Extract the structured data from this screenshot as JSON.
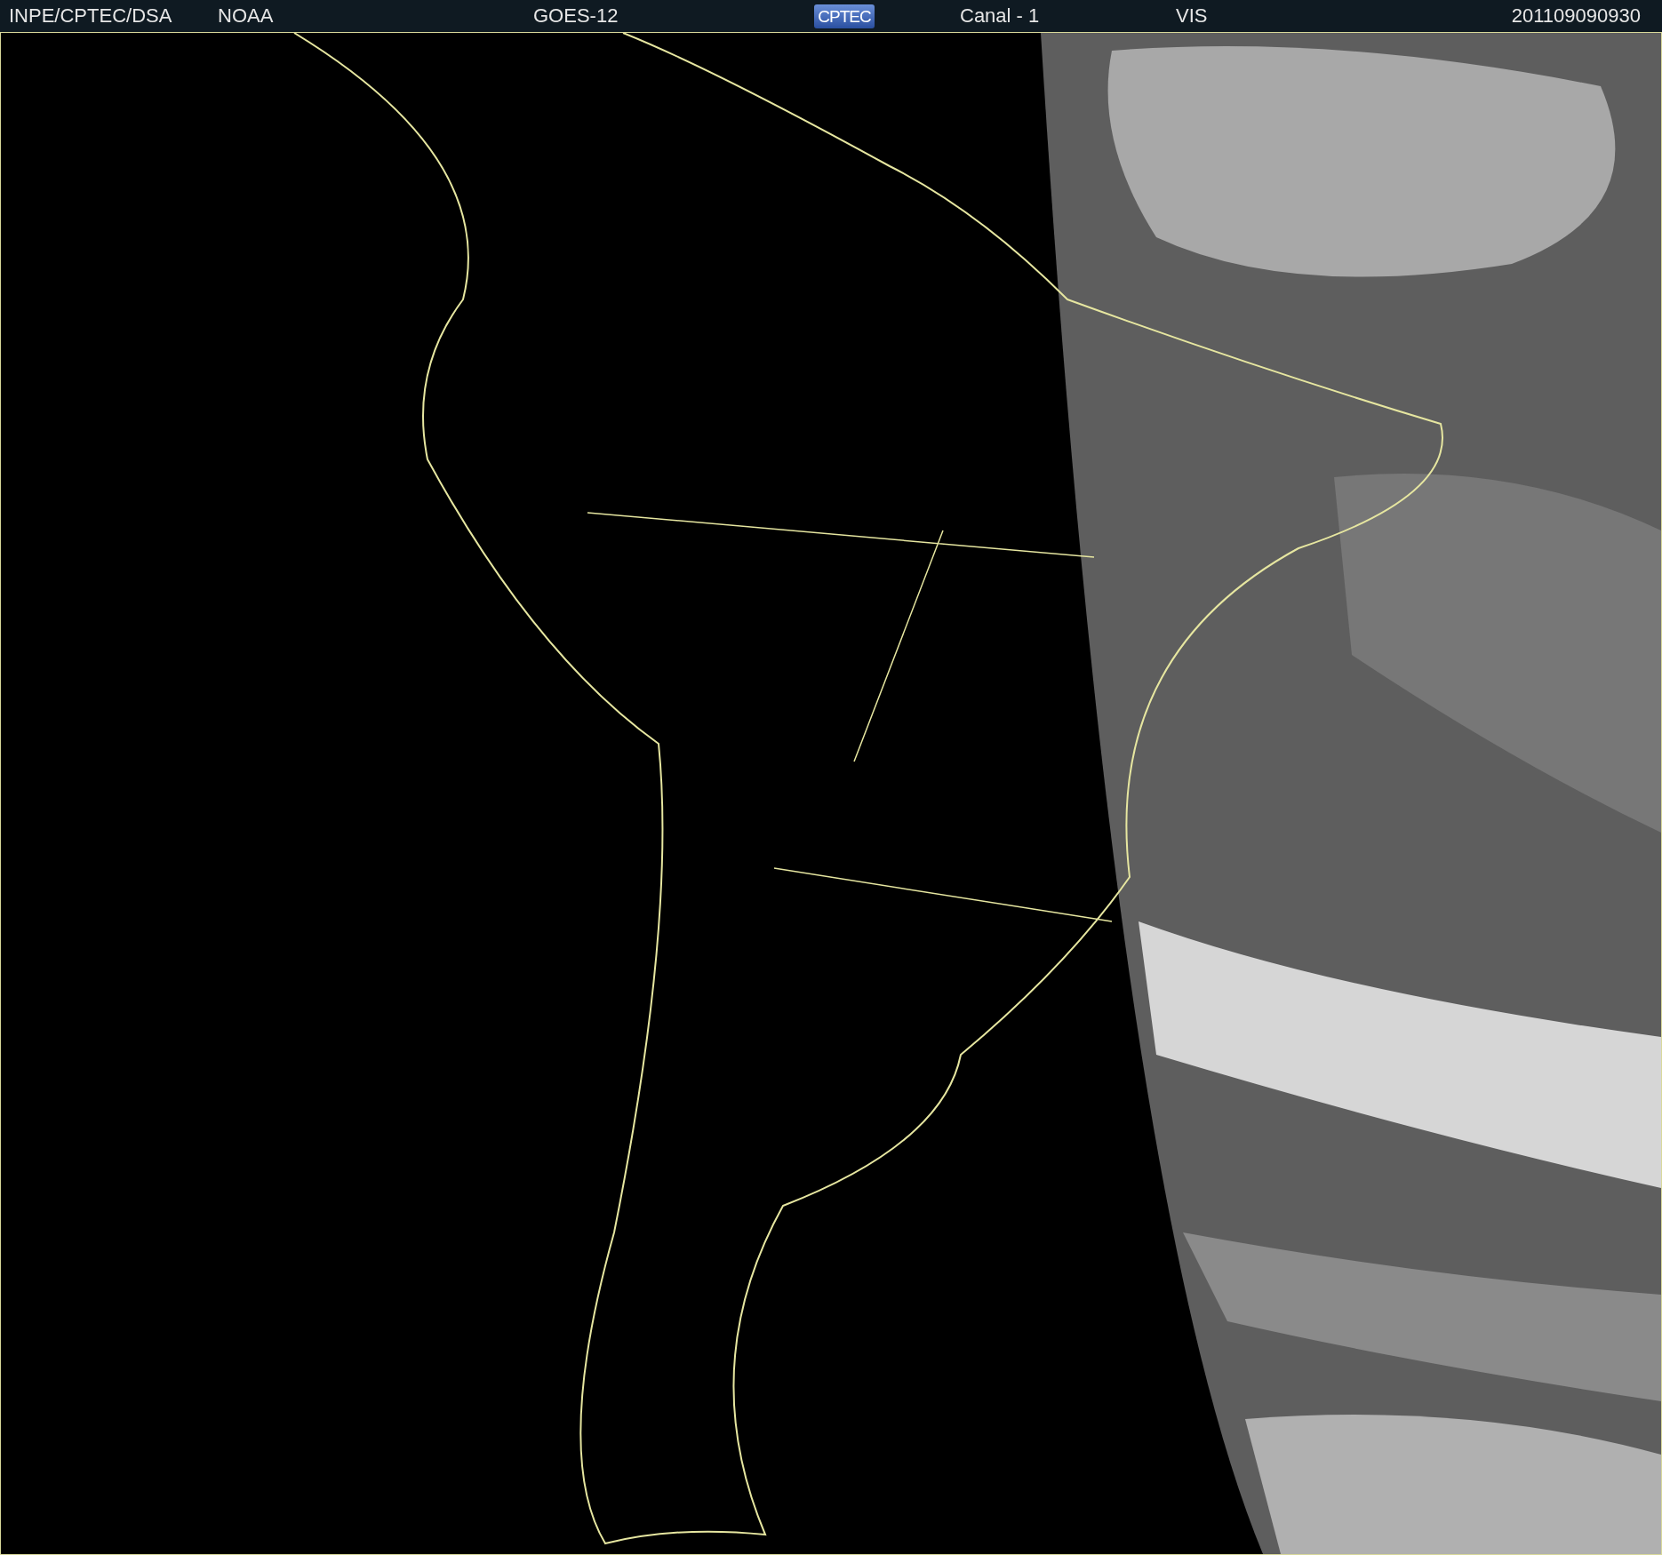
{
  "header": {
    "items": [
      {
        "kind": "text",
        "text": "INPE/CPTEC/DSA"
      },
      {
        "kind": "text",
        "text": "NOAA"
      },
      {
        "kind": "text",
        "text": "GOES-12"
      },
      {
        "kind": "logo",
        "text": "CPTEC"
      },
      {
        "kind": "text",
        "text": "Canal - 1"
      },
      {
        "kind": "text",
        "text": "VIS"
      },
      {
        "kind": "text",
        "text": "201109090930"
      }
    ]
  }
}
